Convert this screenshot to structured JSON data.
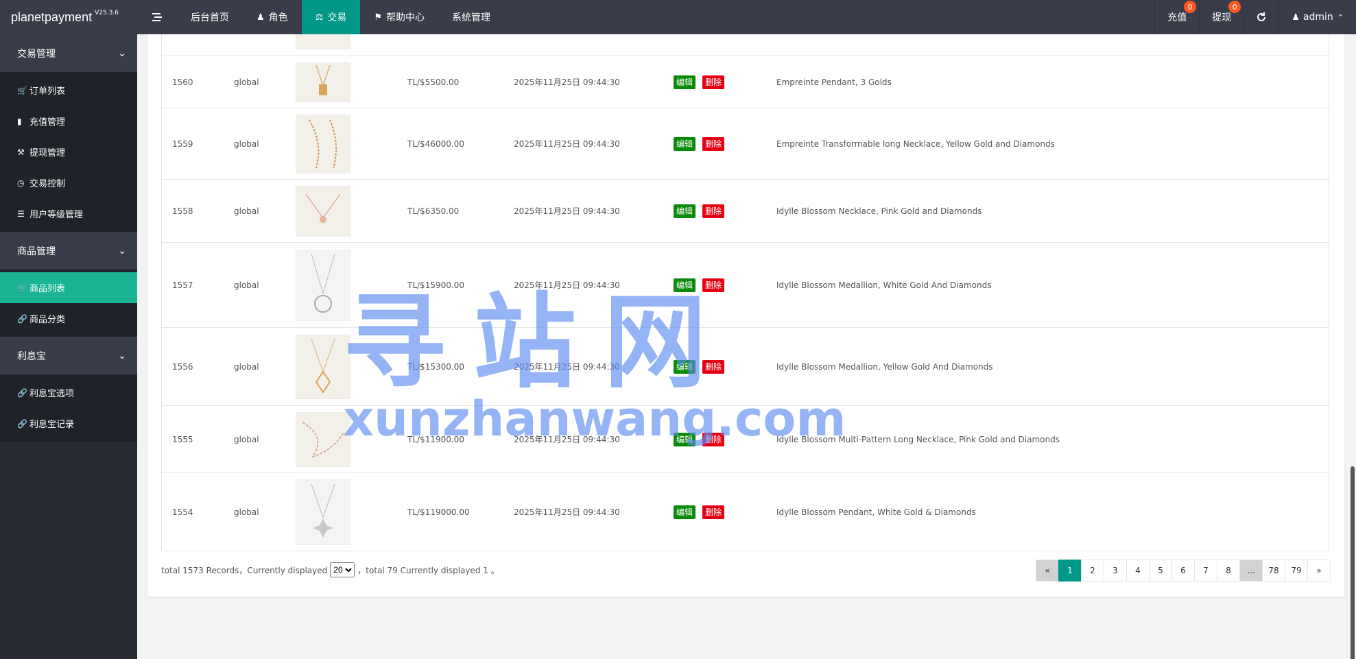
{
  "app": {
    "name": "planetpayment",
    "version": "V25.3.6"
  },
  "nav": [
    {
      "label": "后台首页",
      "icon": ""
    },
    {
      "label": "角色",
      "icon": "user-icon"
    },
    {
      "label": "交易",
      "icon": "scale-icon",
      "active": true
    },
    {
      "label": "帮助中心",
      "icon": "flag-icon"
    },
    {
      "label": "系统管理",
      "icon": ""
    }
  ],
  "topRight": {
    "recharge": {
      "label": "充值",
      "badge": "0"
    },
    "withdraw": {
      "label": "提现",
      "badge": "0"
    },
    "user": "admin"
  },
  "sidebar": {
    "groups": [
      {
        "label": "交易管理",
        "items": [
          {
            "label": "订单列表",
            "icon": "cart-icon"
          },
          {
            "label": "充值管理",
            "icon": "comment-icon"
          },
          {
            "label": "提现管理",
            "icon": "gavel-icon"
          },
          {
            "label": "交易控制",
            "icon": "gauge-icon"
          },
          {
            "label": "用户等级管理",
            "icon": "list-icon"
          }
        ]
      },
      {
        "label": "商品管理",
        "items": [
          {
            "label": "商品列表",
            "icon": "cart-icon",
            "active": true
          },
          {
            "label": "商品分类",
            "icon": "link-icon"
          }
        ]
      },
      {
        "label": "利息宝",
        "items": [
          {
            "label": "利息宝选项",
            "icon": "link-icon"
          },
          {
            "label": "利息宝记录",
            "icon": "link-icon"
          }
        ]
      }
    ]
  },
  "table": {
    "editLabel": "编辑",
    "deleteLabel": "删除",
    "rows": [
      {
        "id": "1560",
        "area": "global",
        "price": "TL/$5500.00",
        "time": "2025年11月25日 09:44:30",
        "name": "Empreinte Pendant, 3 Golds"
      },
      {
        "id": "1559",
        "area": "global",
        "price": "TL/$46000.00",
        "time": "2025年11月25日 09:44:30",
        "name": "Empreinte Transformable long Necklace, Yellow Gold and Diamonds"
      },
      {
        "id": "1558",
        "area": "global",
        "price": "TL/$6350.00",
        "time": "2025年11月25日 09:44:30",
        "name": "Idylle Blossom Necklace, Pink Gold and Diamonds"
      },
      {
        "id": "1557",
        "area": "global",
        "price": "TL/$15900.00",
        "time": "2025年11月25日 09:44:30",
        "name": "Idylle Blossom Medallion, White Gold And Diamonds"
      },
      {
        "id": "1556",
        "area": "global",
        "price": "TL/$15300.00",
        "time": "2025年11月25日 09:44:30",
        "name": "Idylle Blossom Medallion, Yellow Gold And Diamonds"
      },
      {
        "id": "1555",
        "area": "global",
        "price": "TL/$11900.00",
        "time": "2025年11月25日 09:44:30",
        "name": "Idylle Blossom Multi-Pattern Long Necklace, Pink Gold and Diamonds"
      },
      {
        "id": "1554",
        "area": "global",
        "price": "TL/$119000.00",
        "time": "2025年11月25日 09:44:30",
        "name": "Idylle Blossom Pendant, White Gold & Diamonds"
      }
    ]
  },
  "pager": {
    "total_prefix": "total 1573 Records，Currently displayed",
    "page_size": "20",
    "total_suffix": "，total 79 Currently displayed 1 。",
    "pages": [
      "«",
      "1",
      "2",
      "3",
      "4",
      "5",
      "6",
      "7",
      "8",
      "...",
      "78",
      "79",
      "»"
    ],
    "current": "1"
  },
  "watermark": {
    "cn": "寻站网",
    "en": "xunzhanwang.com"
  }
}
